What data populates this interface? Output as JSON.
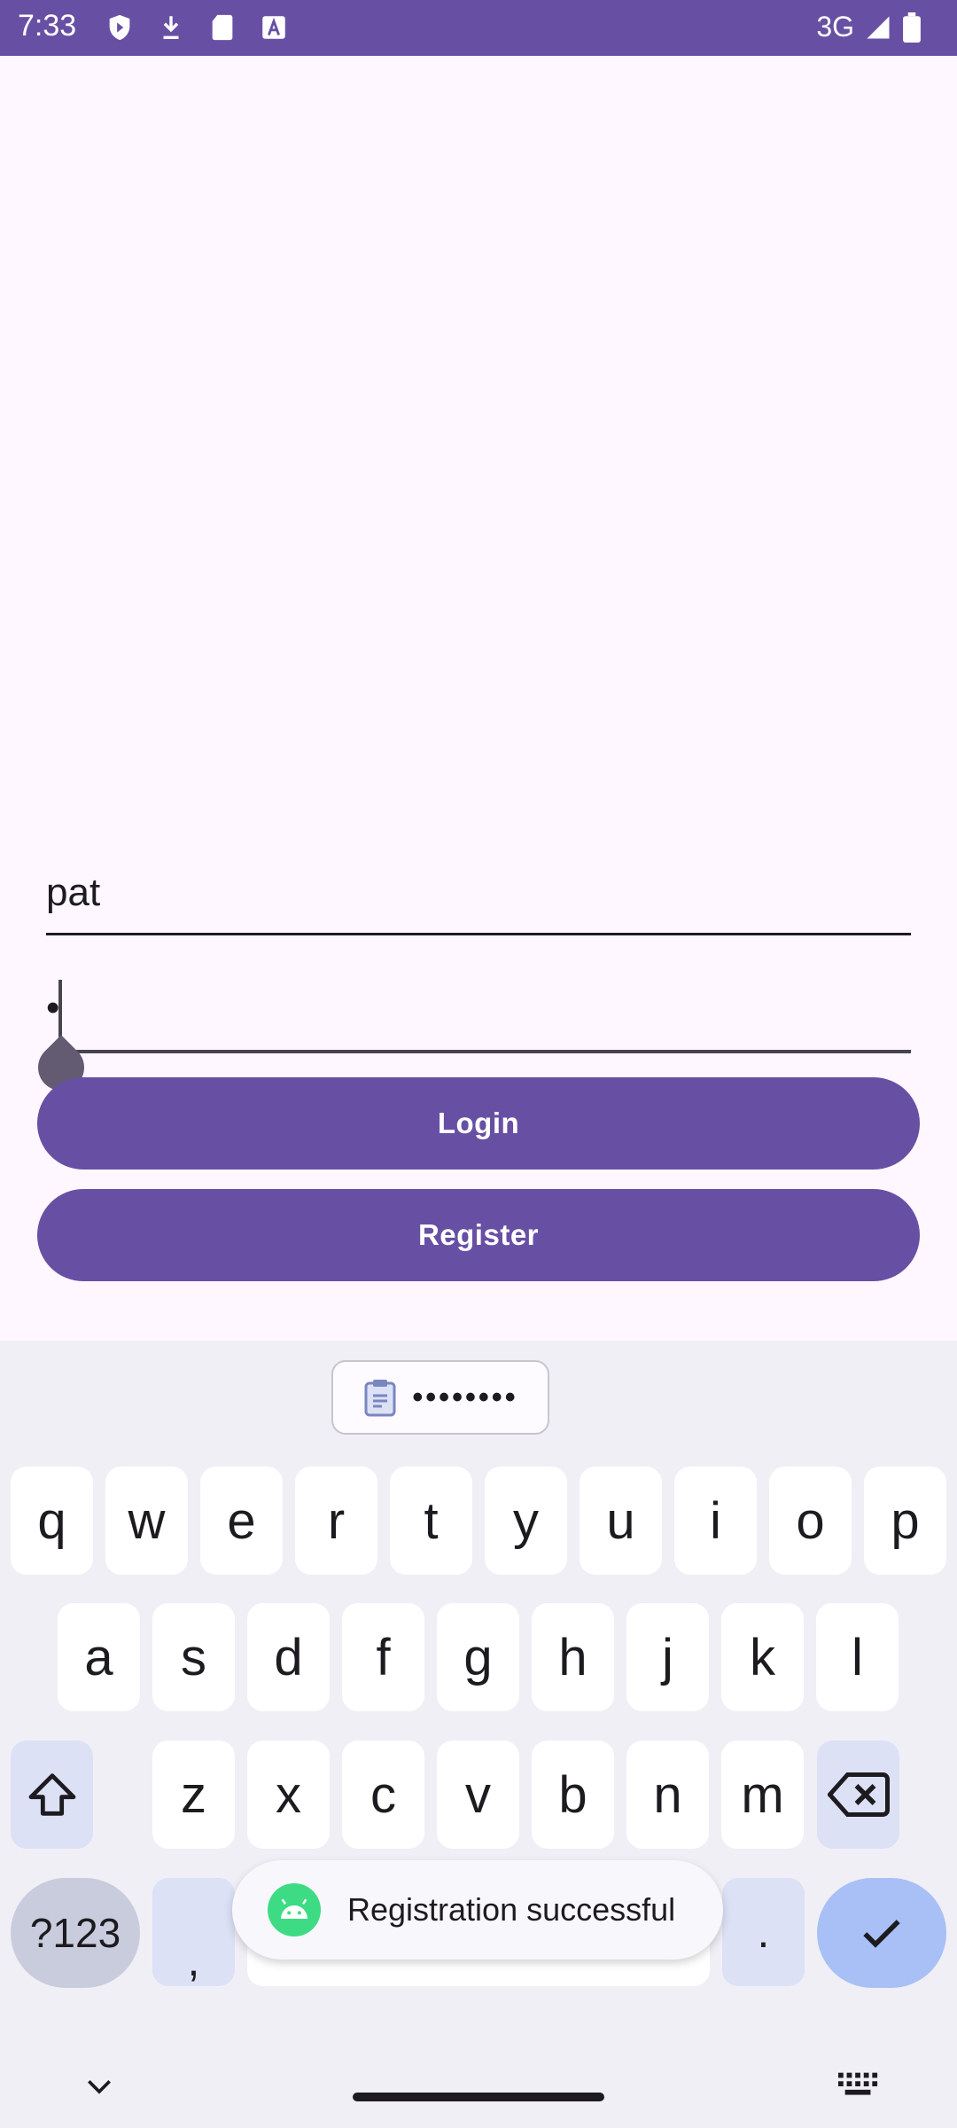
{
  "status_bar": {
    "time": "7:33",
    "network": "3G",
    "icons": [
      "shield-icon",
      "download-status-icon",
      "sd-card-icon",
      "font-icon"
    ]
  },
  "form": {
    "username_value": "pat",
    "password_value": "•"
  },
  "buttons": {
    "login": "Login",
    "register": "Register"
  },
  "keyboard": {
    "clipboard_preview": "••••••••",
    "row1": [
      "q",
      "w",
      "e",
      "r",
      "t",
      "y",
      "u",
      "i",
      "o",
      "p"
    ],
    "row2": [
      "a",
      "s",
      "d",
      "f",
      "g",
      "h",
      "j",
      "k",
      "l"
    ],
    "row3": [
      "z",
      "x",
      "c",
      "v",
      "b",
      "n",
      "m"
    ],
    "symbols_label": "?123",
    "comma": ",",
    "period": "."
  },
  "toast": {
    "message": "Registration successful"
  },
  "colors": {
    "primary": "#6750A4",
    "background": "#FEF7FF",
    "keyboard_bg": "#F1EFF6"
  }
}
